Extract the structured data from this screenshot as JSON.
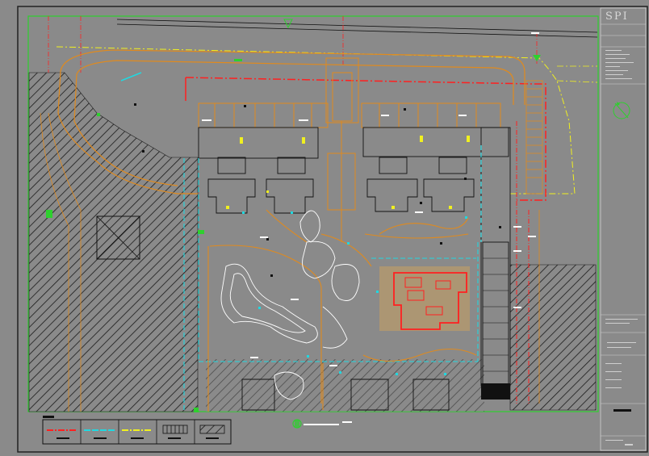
{
  "drawing": {
    "title_block_logo": "SPI",
    "colors": {
      "background": "#8a8a8a",
      "boundary_green": "#2ed02e",
      "red_line": "#ff2020",
      "orange_line": "#e08a1e",
      "cyan_line": "#20d8e0",
      "yellow_line": "#f0f020",
      "white_line": "#ffffff",
      "hatch": "#1a1a1a"
    },
    "legend": {
      "items": [
        {
          "symbol": "red-dash-line",
          "color": "#ff2020"
        },
        {
          "symbol": "cyan-dash-line",
          "color": "#20d8e0"
        },
        {
          "symbol": "yellow-dash-line",
          "color": "#f0f020"
        },
        {
          "symbol": "grid-pattern",
          "color": "#ffffff"
        },
        {
          "symbol": "hatch-pattern",
          "color": "#1a1a1a"
        }
      ]
    },
    "icons": [
      "north-arrow-icon",
      "section-marker-icon"
    ]
  }
}
